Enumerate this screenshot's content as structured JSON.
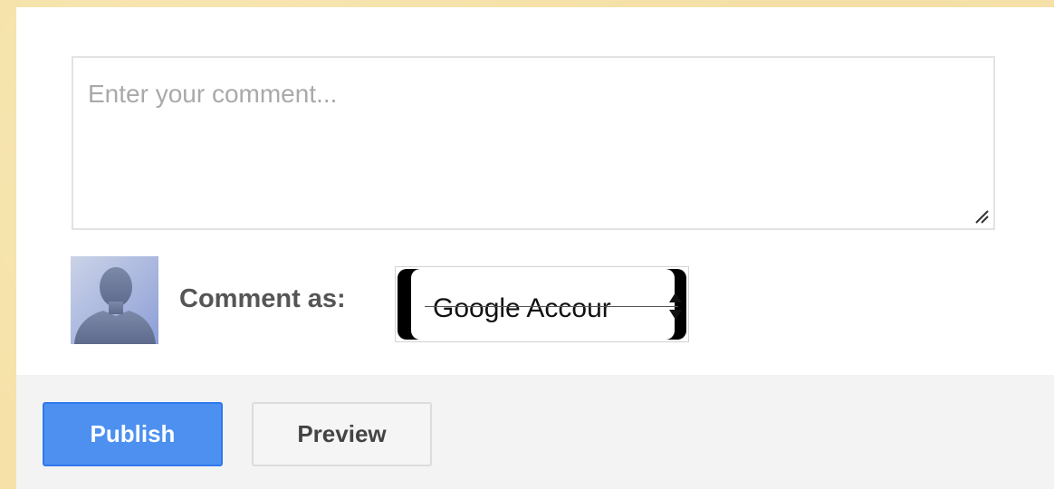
{
  "comment": {
    "placeholder": "Enter your comment..."
  },
  "identity": {
    "label": "Comment as:",
    "selected_account": "Google Accour"
  },
  "actions": {
    "publish_label": "Publish",
    "preview_label": "Preview"
  },
  "colors": {
    "publish_bg": "#4d90f0",
    "background": "#f6e2a8"
  }
}
